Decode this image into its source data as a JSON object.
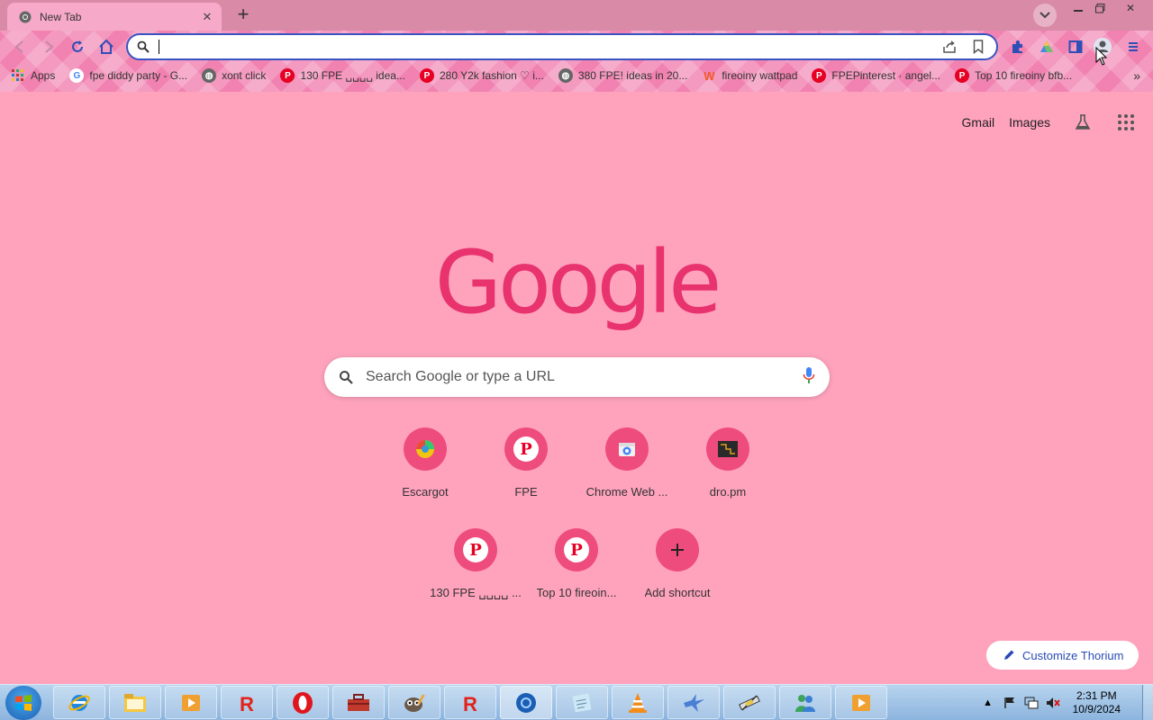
{
  "window": {
    "tab_title": "New Tab",
    "tab_favicon": "chrome-icon",
    "controls": [
      "minimize",
      "restore",
      "close"
    ]
  },
  "toolbar": {
    "omnibox_value": ""
  },
  "bookmarks": [
    {
      "label": "Apps",
      "icon": "apps-grid-icon"
    },
    {
      "label": "fpe diddy party - G...",
      "icon": "google-icon"
    },
    {
      "label": "xont click",
      "icon": "globe-icon"
    },
    {
      "label": "130 FPE ␣␣␣␣ idea...",
      "icon": "pinterest-icon"
    },
    {
      "label": "280 Y2k fashion ♡ i...",
      "icon": "pinterest-icon"
    },
    {
      "label": "380 FPE! ideas in 20...",
      "icon": "globe-icon"
    },
    {
      "label": "fireoiny wattpad",
      "icon": "wattpad-icon"
    },
    {
      "label": "FPEPinterest · angel...",
      "icon": "pinterest-icon"
    },
    {
      "label": "Top 10 fireoiny bfb...",
      "icon": "pinterest-icon"
    }
  ],
  "ntp": {
    "links": {
      "gmail": "Gmail",
      "images": "Images"
    },
    "logo": "Google",
    "search_placeholder": "Search Google or type a URL",
    "shortcuts": [
      {
        "label": "Escargot",
        "icon": "escargot-icon"
      },
      {
        "label": "FPE",
        "icon": "pinterest-icon"
      },
      {
        "label": "Chrome Web ...",
        "icon": "chrome-web-store-icon"
      },
      {
        "label": "dro.pm",
        "icon": "dropm-icon"
      },
      {
        "label": "130 FPE ␣␣␣␣ ...",
        "icon": "pinterest-icon"
      },
      {
        "label": "Top 10 fireoin...",
        "icon": "pinterest-icon"
      },
      {
        "label": "Add shortcut",
        "icon": "plus-icon"
      }
    ],
    "customize_label": "Customize Thorium"
  },
  "taskbar": {
    "clock_time": "2:31 PM",
    "clock_date": "10/9/2024",
    "apps": [
      "internet-explorer",
      "file-explorer",
      "media-player",
      "roblox",
      "opera",
      "toolbox",
      "gimp",
      "roblox-studio",
      "chromium",
      "notepad",
      "vlc",
      "bird-app",
      "satellite-app",
      "messenger",
      "media-player-2"
    ]
  },
  "colors": {
    "page_bg": "#ffa3bd",
    "accent": "#e8336e",
    "shortcut_circle": "#ef4c7e",
    "omnibox_border": "#3a53c4"
  }
}
